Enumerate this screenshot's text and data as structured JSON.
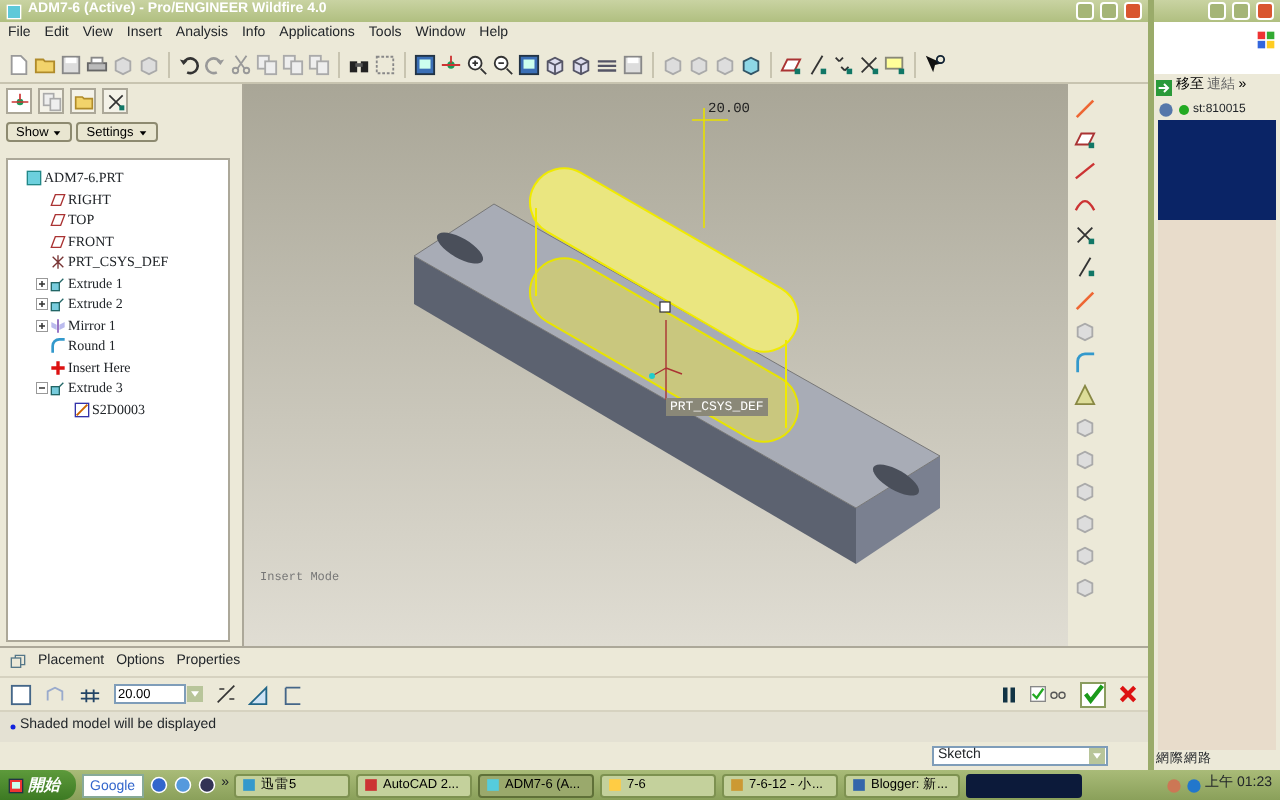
{
  "window": {
    "title": "ADM7-6 (Active) - Pro/ENGINEER Wildfire 4.0"
  },
  "menu": [
    "File",
    "Edit",
    "View",
    "Insert",
    "Analysis",
    "Info",
    "Applications",
    "Tools",
    "Window",
    "Help"
  ],
  "navigator": {
    "buttons": [
      "Show",
      "Settings"
    ]
  },
  "tree": [
    {
      "label": "ADM7-6.PRT",
      "kind": "part"
    },
    {
      "label": "RIGHT",
      "kind": "plane"
    },
    {
      "label": "TOP",
      "kind": "plane"
    },
    {
      "label": "FRONT",
      "kind": "plane"
    },
    {
      "label": "PRT_CSYS_DEF",
      "kind": "csys"
    },
    {
      "label": "Extrude 1",
      "kind": "extrude",
      "expanded": false
    },
    {
      "label": "Extrude 2",
      "kind": "extrude",
      "expanded": false
    },
    {
      "label": "Mirror 1",
      "kind": "mirror",
      "expanded": false
    },
    {
      "label": "Round 1",
      "kind": "round"
    },
    {
      "label": "Insert Here",
      "kind": "insert"
    },
    {
      "label": "Extrude 3",
      "kind": "extrude",
      "expanded": true,
      "children": [
        {
          "label": "S2D0003",
          "kind": "sketch"
        }
      ]
    }
  ],
  "viewport": {
    "dimension": "20.00",
    "csys_label": "PRT_CSYS_DEF",
    "mode": "Insert Mode"
  },
  "dashboard": {
    "tabs": [
      "Placement",
      "Options",
      "Properties"
    ],
    "depth": "20.00",
    "preview_checked": true
  },
  "message": "Shaded model will be displayed",
  "filter": "Sketch",
  "side_window": {
    "buttons": [
      "移至",
      "連結"
    ],
    "more": "»",
    "address": "st:810015",
    "status": "網際網路"
  },
  "taskbar": {
    "start": "開始",
    "search": "Google",
    "more": "»",
    "tasks": [
      {
        "label": "迅雷5",
        "selected": false
      },
      {
        "label": "AutoCAD 2...",
        "selected": false
      },
      {
        "label": "ADM7-6 (A...",
        "selected": true
      },
      {
        "label": "7-6",
        "selected": false
      },
      {
        "label": "7-6-12 - 小...",
        "selected": false
      },
      {
        "label": "Blogger: 新...",
        "selected": false
      }
    ],
    "clock": "上午 01:23"
  }
}
